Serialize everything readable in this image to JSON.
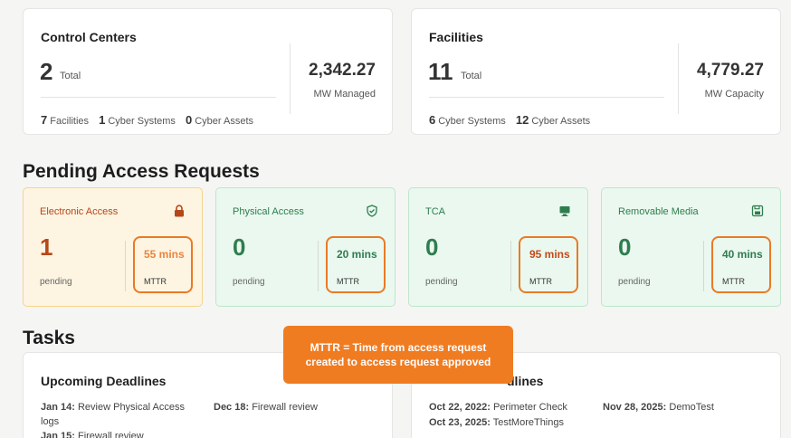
{
  "control_centers": {
    "title": "Control Centers",
    "total_value": "2",
    "total_label": "Total",
    "right_value": "2,342.27",
    "right_label": "MW Managed",
    "stats": [
      {
        "value": "7",
        "label": "Facilities"
      },
      {
        "value": "1",
        "label": "Cyber Systems"
      },
      {
        "value": "0",
        "label": "Cyber Assets"
      }
    ]
  },
  "facilities": {
    "title": "Facilities",
    "total_value": "11",
    "total_label": "Total",
    "right_value": "4,779.27",
    "right_label": "MW Capacity",
    "stats": [
      {
        "value": "6",
        "label": "Cyber Systems"
      },
      {
        "value": "12",
        "label": "Cyber Assets"
      }
    ]
  },
  "pending": {
    "heading": "Pending Access Requests",
    "cards": [
      {
        "title": "Electronic Access",
        "icon": "lock-icon",
        "count": "1",
        "pending_label": "pending",
        "mttr_value": "55 mins",
        "mttr_label": "MTTR",
        "color": "#b5471a",
        "mttr_color": "#e9853f"
      },
      {
        "title": "Physical Access",
        "icon": "shield-check-icon",
        "count": "0",
        "pending_label": "pending",
        "mttr_value": "20 mins",
        "mttr_label": "MTTR",
        "color": "#2f7d4f",
        "mttr_color": "#2f7d4f"
      },
      {
        "title": "TCA",
        "icon": "monitor-icon",
        "count": "0",
        "pending_label": "pending",
        "mttr_value": "95 mins",
        "mttr_label": "MTTR",
        "color": "#2f7d4f",
        "mttr_color": "#c24a18"
      },
      {
        "title": "Removable Media",
        "icon": "save-disk-icon",
        "count": "0",
        "pending_label": "pending",
        "mttr_value": "40 mins",
        "mttr_label": "MTTR",
        "color": "#2f7d4f",
        "mttr_color": "#2f7d4f"
      }
    ]
  },
  "callout": {
    "text": "MTTR = Time from access request created to access request approved",
    "color": "#f07c22"
  },
  "tasks": {
    "heading": "Tasks",
    "upcoming": {
      "title": "Upcoming Deadlines",
      "items": [
        {
          "date": "Jan 14:",
          "text": "Review Physical Access logs"
        },
        {
          "date": "Dec 18:",
          "text": "Firewall review"
        },
        {
          "date": "Jan 15:",
          "text": "Firewall review"
        }
      ]
    },
    "second": {
      "title_partial": "dlines",
      "items": [
        {
          "date": "Oct 22, 2022:",
          "text": "Perimeter Check"
        },
        {
          "date": "Nov 28, 2025:",
          "text": "DemoTest"
        },
        {
          "date": "Oct 23, 2025:",
          "text": "TestMoreThings"
        }
      ]
    }
  }
}
